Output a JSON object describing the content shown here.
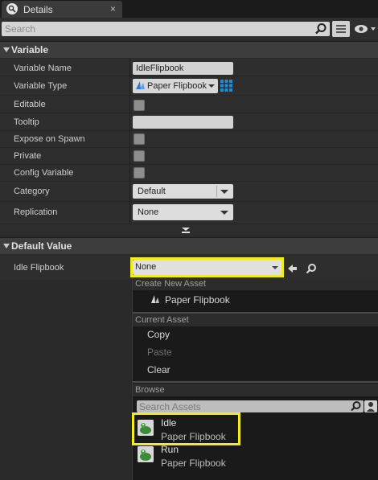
{
  "tab": {
    "title": "Details",
    "close": "×"
  },
  "search": {
    "placeholder": "Search"
  },
  "variable": {
    "section_title": "Variable",
    "rows": {
      "variable_name": {
        "label": "Variable Name",
        "value": "IdleFlipbook"
      },
      "variable_type": {
        "label": "Variable Type",
        "value": "Paper Flipbook"
      },
      "editable": {
        "label": "Editable"
      },
      "tooltip": {
        "label": "Tooltip",
        "value": ""
      },
      "expose_on_spawn": {
        "label": "Expose on Spawn"
      },
      "private": {
        "label": "Private"
      },
      "config_variable": {
        "label": "Config Variable"
      },
      "category": {
        "label": "Category",
        "value": "Default"
      },
      "replication": {
        "label": "Replication",
        "value": "None"
      }
    }
  },
  "default_value": {
    "section_title": "Default Value",
    "label": "Idle Flipbook",
    "value": "None"
  },
  "dropdown": {
    "create_new_header": "Create New Asset",
    "create_item": "Paper Flipbook",
    "current_header": "Current Asset",
    "copy": "Copy",
    "paste": "Paste",
    "clear": "Clear",
    "browse_header": "Browse",
    "search_placeholder": "Search Assets",
    "assets": [
      {
        "name": "Idle",
        "type": "Paper Flipbook"
      },
      {
        "name": "Run",
        "type": "Paper Flipbook"
      }
    ]
  },
  "colors": {
    "highlight": "#f2ec1c",
    "panel": "#2e2e2e",
    "accent_grid": "#1a8fe0"
  }
}
